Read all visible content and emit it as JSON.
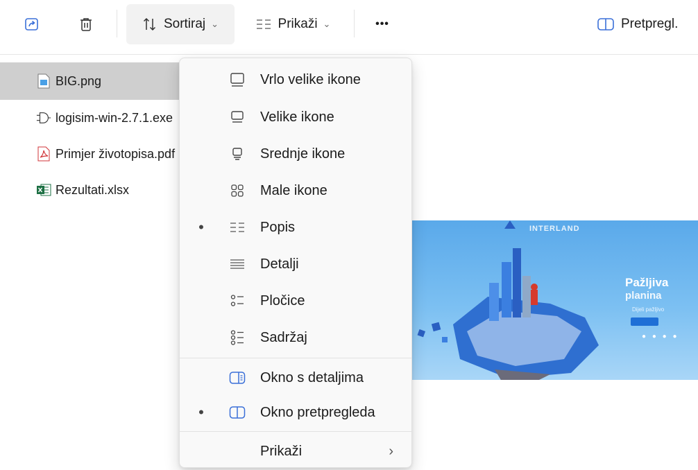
{
  "toolbar": {
    "sort_label": "Sortiraj",
    "view_label": "Prikaži",
    "more_label": "•••",
    "chevron": "⌄",
    "preview_label": "Pretpregl."
  },
  "files": [
    {
      "name": "BIG.png",
      "icon": "image-file-icon",
      "selected": true
    },
    {
      "name": "logisim-win-2.7.1.exe",
      "icon": "logic-gate-icon",
      "selected": false
    },
    {
      "name": "Primjer životopisa.pdf",
      "icon": "pdf-file-icon",
      "selected": false
    },
    {
      "name": "Rezultati.xlsx",
      "icon": "excel-file-icon",
      "selected": false
    }
  ],
  "preview": {
    "brand": "INTERLAND",
    "title_line1": "Pažljiva",
    "title_line2": "planina",
    "subtitle": "Dijeli pažljivo",
    "dots": "● ● ● ●"
  },
  "menu": {
    "items": [
      {
        "label": "Vrlo velike ikone",
        "icon": "extra-large-icons-icon",
        "checked": false
      },
      {
        "label": "Velike ikone",
        "icon": "large-icons-icon",
        "checked": false
      },
      {
        "label": "Srednje ikone",
        "icon": "medium-icons-icon",
        "checked": false
      },
      {
        "label": "Male ikone",
        "icon": "small-icons-icon",
        "checked": false
      },
      {
        "label": "Popis",
        "icon": "list-icon",
        "checked": true
      },
      {
        "label": "Detalji",
        "icon": "details-icon",
        "checked": false
      },
      {
        "label": "Pločice",
        "icon": "tiles-icon",
        "checked": false
      },
      {
        "label": "Sadržaj",
        "icon": "content-icon",
        "checked": false
      },
      {
        "label": "Okno s detaljima",
        "icon": "details-pane-icon",
        "checked": false
      },
      {
        "label": "Okno pretpregleda",
        "icon": "preview-pane-icon",
        "checked": true
      },
      {
        "label": "Prikaži",
        "icon": "",
        "checked": false
      }
    ],
    "bullet": "•",
    "submenu_chevron": "›"
  }
}
